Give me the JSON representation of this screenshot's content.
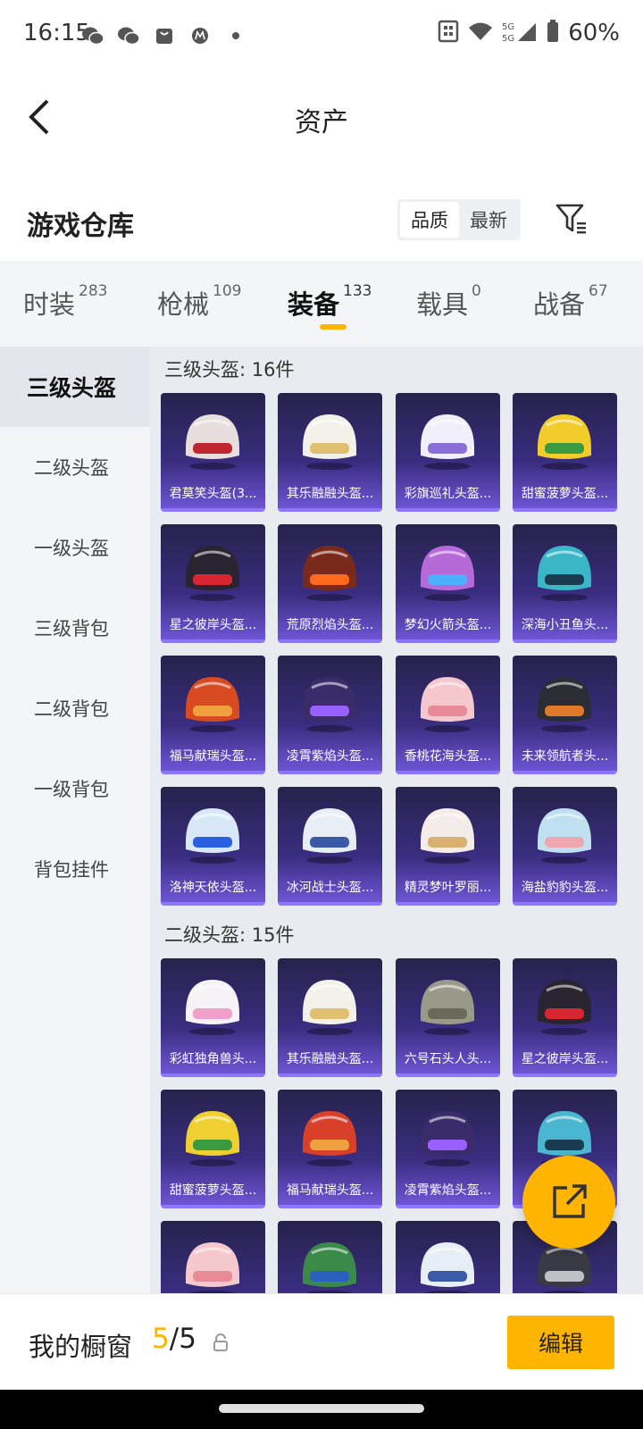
{
  "status_bar": {
    "time": "16:15",
    "network": "5G",
    "battery": "60%"
  },
  "header": {
    "title": "资产"
  },
  "section": {
    "title": "游戏仓库",
    "sort_options": [
      "品质",
      "最新"
    ],
    "active_sort": "品质"
  },
  "tabs": [
    {
      "label": "时装",
      "count": "283"
    },
    {
      "label": "枪械",
      "count": "109"
    },
    {
      "label": "装备",
      "count": "133"
    },
    {
      "label": "载具",
      "count": "0"
    },
    {
      "label": "战备",
      "count": "67"
    }
  ],
  "active_tab": "装备",
  "sidebar": [
    "三级头盔",
    "二级头盔",
    "一级头盔",
    "三级背包",
    "二级背包",
    "一级背包",
    "背包挂件"
  ],
  "active_sidebar": "三级头盔",
  "groups": [
    {
      "title": "三级头盔: 16件",
      "items": [
        {
          "label": "君莫笑头盔(3...",
          "color": "#e9dede",
          "accent": "#c0262f"
        },
        {
          "label": "其乐融融头盔...",
          "color": "#f3f1ea",
          "accent": "#e0c070"
        },
        {
          "label": "彩旗巡礼头盔...",
          "color": "#f1effa",
          "accent": "#8a6fd8"
        },
        {
          "label": "甜蜜菠萝头盔...",
          "color": "#f1cc2a",
          "accent": "#3a9a40"
        },
        {
          "label": "星之彼岸头盔...",
          "color": "#2a2430",
          "accent": "#d7262f"
        },
        {
          "label": "荒原烈焰头盔...",
          "color": "#7a2a1c",
          "accent": "#ff6a1e"
        },
        {
          "label": "梦幻火箭头盔...",
          "color": "#b66ad8",
          "accent": "#4ab0ff"
        },
        {
          "label": "深海小丑鱼头...",
          "color": "#3ab6c6",
          "accent": "#1a3a50"
        },
        {
          "label": "福马献瑞头盔...",
          "color": "#d84a20",
          "accent": "#f0a040"
        },
        {
          "label": "凌霄紫焰头盔...",
          "color": "#3a2c6a",
          "accent": "#9a60ff"
        },
        {
          "label": "香桃花海头盔...",
          "color": "#f4c8cc",
          "accent": "#e88a98"
        },
        {
          "label": "未来领航者头...",
          "color": "#2c2c34",
          "accent": "#e07a2a"
        },
        {
          "label": "洛神天依头盔...",
          "color": "#d8e8f8",
          "accent": "#2a60e0"
        },
        {
          "label": "冰河战士头盔...",
          "color": "#e8eef6",
          "accent": "#3a5aa8"
        },
        {
          "label": "精灵梦叶罗丽...",
          "color": "#f4ece8",
          "accent": "#d8b070"
        },
        {
          "label": "海盐豹豹头盔...",
          "color": "#bfe0f0",
          "accent": "#f0a8b0"
        }
      ]
    },
    {
      "title": "二级头盔: 15件",
      "items": [
        {
          "label": "彩虹独角兽头...",
          "color": "#f6f2f6",
          "accent": "#f0a0c8"
        },
        {
          "label": "其乐融融头盔...",
          "color": "#f3f1ea",
          "accent": "#e0c070"
        },
        {
          "label": "六号石头人头...",
          "color": "#9a9a8a",
          "accent": "#6a6a5a"
        },
        {
          "label": "星之彼岸头盔...",
          "color": "#2a2430",
          "accent": "#d7262f"
        },
        {
          "label": "甜蜜菠萝头盔...",
          "color": "#f0d030",
          "accent": "#3a9a40"
        },
        {
          "label": "福马献瑞头盔...",
          "color": "#d8402a",
          "accent": "#f0a040"
        },
        {
          "label": "凌霄紫焰头盔...",
          "color": "#3a2c6a",
          "accent": "#9a60ff"
        },
        {
          "label": "",
          "color": "#4ab6d0",
          "accent": "#1a3a50"
        },
        {
          "label": "",
          "color": "#f4c8cc",
          "accent": "#e88a98"
        },
        {
          "label": "",
          "color": "#3a8a4a",
          "accent": "#2a60c0"
        },
        {
          "label": "",
          "color": "#e8eef6",
          "accent": "#3a5aa8"
        },
        {
          "label": "",
          "color": "#3a3a44",
          "accent": "#c0c0c8"
        }
      ]
    }
  ],
  "bottom_bar": {
    "label": "我的橱窗",
    "current": "5",
    "separator": "/",
    "total": "5",
    "edit_label": "编辑"
  }
}
